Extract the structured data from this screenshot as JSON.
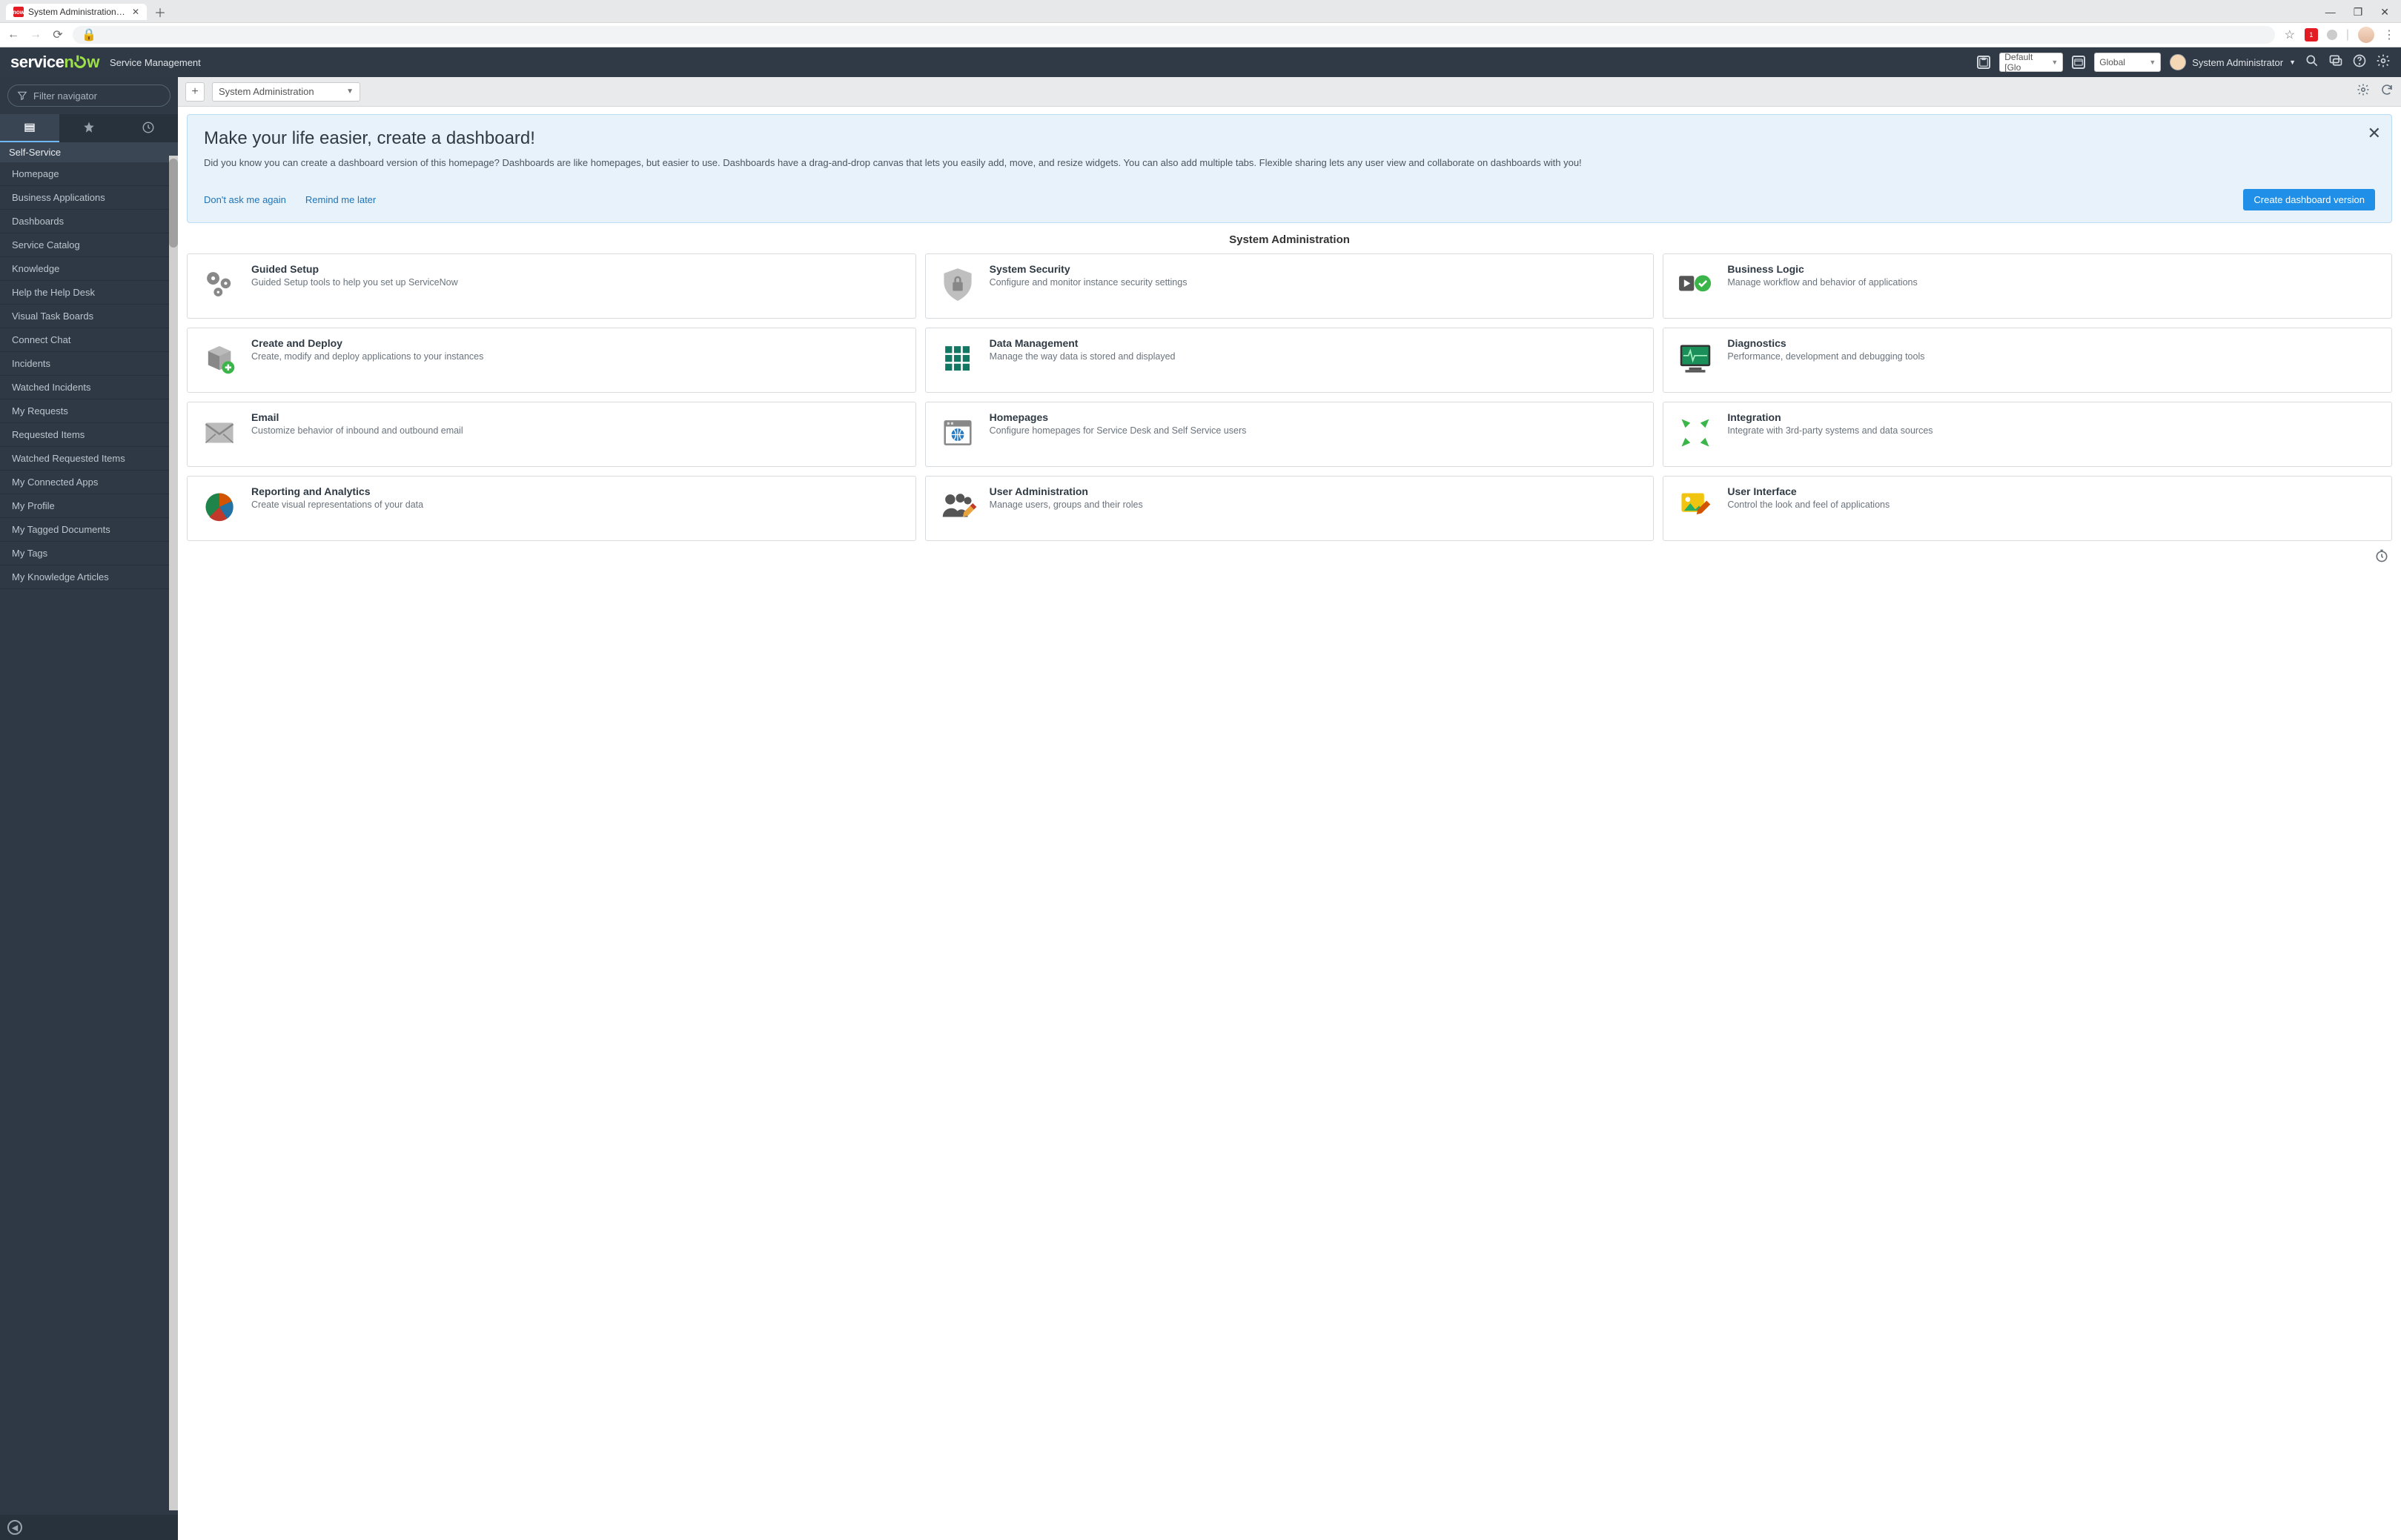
{
  "browser": {
    "tab_title": "System Administration | ServiceN",
    "favicon_text": "now"
  },
  "banner": {
    "brand_sub": "Service Management",
    "picker1": "Default [Glo",
    "picker2": "Global",
    "user_name": "System Administrator"
  },
  "leftnav": {
    "filter_placeholder": "Filter navigator",
    "section": "Self-Service",
    "items": [
      "Homepage",
      "Business Applications",
      "Dashboards",
      "Service Catalog",
      "Knowledge",
      "Help the Help Desk",
      "Visual Task Boards",
      "Connect Chat",
      "Incidents",
      "Watched Incidents",
      "My Requests",
      "Requested Items",
      "Watched Requested Items",
      "My Connected Apps",
      "My Profile",
      "My Tagged Documents",
      "My Tags",
      "My Knowledge Articles"
    ]
  },
  "toolbar": {
    "select_value": "System Administration"
  },
  "promo": {
    "title": "Make your life easier, create a dashboard!",
    "body": "Did you know you can create a dashboard version of this homepage? Dashboards are like homepages, but easier to use. Dashboards have a drag-and-drop canvas that lets you easily add, move, and resize widgets. You can also add multiple tabs. Flexible sharing lets any user view and collaborate on dashboards with you!",
    "dont_ask": "Don't ask me again",
    "remind": "Remind me later",
    "cta": "Create dashboard version"
  },
  "page_title": "System Administration",
  "cards": [
    {
      "title": "Guided Setup",
      "desc": "Guided Setup tools to help you set up ServiceNow"
    },
    {
      "title": "System Security",
      "desc": "Configure and monitor instance security settings"
    },
    {
      "title": "Business Logic",
      "desc": "Manage workflow and behavior of applications"
    },
    {
      "title": "Create and Deploy",
      "desc": "Create, modify and deploy applications to your instances"
    },
    {
      "title": "Data Management",
      "desc": "Manage the way data is stored and displayed"
    },
    {
      "title": "Diagnostics",
      "desc": "Performance, development and debugging tools"
    },
    {
      "title": "Email",
      "desc": "Customize behavior of inbound and outbound email"
    },
    {
      "title": "Homepages",
      "desc": "Configure homepages for Service Desk and Self Service users"
    },
    {
      "title": "Integration",
      "desc": "Integrate with 3rd-party systems and data sources"
    },
    {
      "title": "Reporting and Analytics",
      "desc": "Create visual representations of your data"
    },
    {
      "title": "User Administration",
      "desc": "Manage users, groups and their roles"
    },
    {
      "title": "User Interface",
      "desc": "Control the look and feel of applications"
    }
  ]
}
